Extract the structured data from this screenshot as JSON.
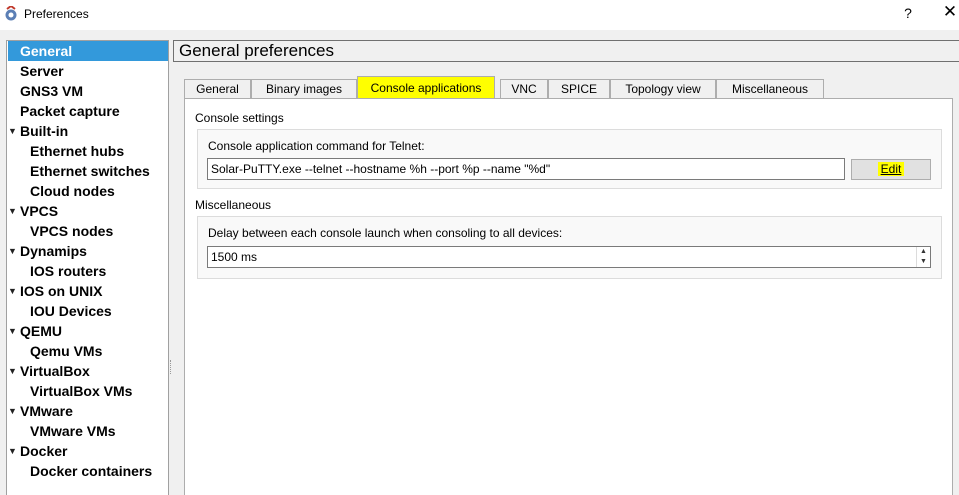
{
  "window": {
    "title": "Preferences",
    "help_label": "?",
    "close_label": "✕"
  },
  "sidebar": {
    "items": [
      {
        "label": "General",
        "level": 0,
        "expandable": false,
        "selected": true
      },
      {
        "label": "Server",
        "level": 0,
        "expandable": false
      },
      {
        "label": "GNS3 VM",
        "level": 0,
        "expandable": false
      },
      {
        "label": "Packet capture",
        "level": 0,
        "expandable": false
      },
      {
        "label": "Built-in",
        "level": 0,
        "expandable": true
      },
      {
        "label": "Ethernet hubs",
        "level": 1
      },
      {
        "label": "Ethernet switches",
        "level": 1
      },
      {
        "label": "Cloud nodes",
        "level": 1
      },
      {
        "label": "VPCS",
        "level": 0,
        "expandable": true
      },
      {
        "label": "VPCS nodes",
        "level": 1
      },
      {
        "label": "Dynamips",
        "level": 0,
        "expandable": true
      },
      {
        "label": "IOS routers",
        "level": 1
      },
      {
        "label": "IOS on UNIX",
        "level": 0,
        "expandable": true
      },
      {
        "label": "IOU Devices",
        "level": 1
      },
      {
        "label": "QEMU",
        "level": 0,
        "expandable": true
      },
      {
        "label": "Qemu VMs",
        "level": 1
      },
      {
        "label": "VirtualBox",
        "level": 0,
        "expandable": true
      },
      {
        "label": "VirtualBox VMs",
        "level": 1
      },
      {
        "label": "VMware",
        "level": 0,
        "expandable": true
      },
      {
        "label": "VMware VMs",
        "level": 1
      },
      {
        "label": "Docker",
        "level": 0,
        "expandable": true
      },
      {
        "label": "Docker containers",
        "level": 1
      }
    ]
  },
  "main": {
    "header": "General preferences",
    "tabs": [
      {
        "label": "General"
      },
      {
        "label": "Binary images"
      },
      {
        "label": "Console applications",
        "active": true
      },
      {
        "label": "VNC"
      },
      {
        "label": "SPICE"
      },
      {
        "label": "Topology view"
      },
      {
        "label": "Miscellaneous"
      }
    ],
    "console_settings": {
      "title": "Console settings",
      "telnet_label": "Console application command for Telnet:",
      "telnet_value": "Solar-PuTTY.exe --telnet --hostname %h --port %p  --name \"%d\"",
      "edit_label": "Edit"
    },
    "miscellaneous": {
      "title": "Miscellaneous",
      "delay_label": "Delay between each console launch when consoling to all devices:",
      "delay_value": "1500 ms"
    }
  },
  "colors": {
    "selection": "#3399db",
    "highlight": "#ffff00"
  }
}
